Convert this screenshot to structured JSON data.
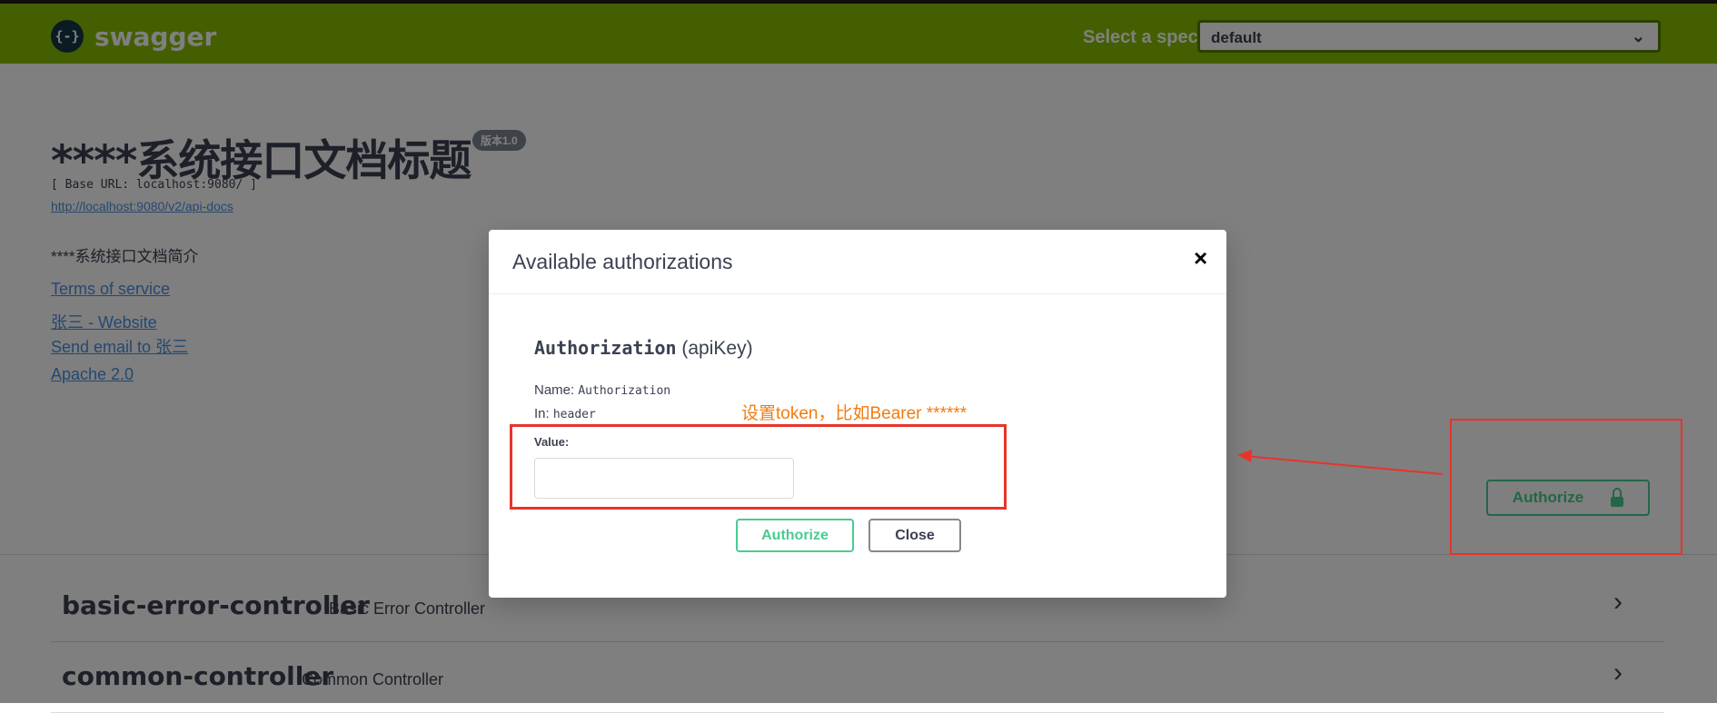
{
  "topbar": {
    "logo_glyph": "{-}",
    "logo_text": "swagger",
    "spec_label": "Select a spec",
    "spec_value": "default",
    "brand_color": "#89bf04"
  },
  "info": {
    "title": "****系统接口文档标题",
    "version": "版本1.0",
    "base_url": "[ Base URL: localhost:9080/ ]",
    "api_docs_link": "http://localhost:9080/v2/api-docs",
    "description": "****系统接口文档简介",
    "links": {
      "terms": "Terms of service",
      "website": "张三 - Website",
      "email": "Send email to 张三",
      "license": "Apache 2.0"
    }
  },
  "authorize_button": {
    "label": "Authorize",
    "icon": "lock-icon"
  },
  "tags": [
    {
      "name": "basic-error-controller",
      "description": "Basic Error Controller",
      "icon": "chevron-right-icon"
    },
    {
      "name": "common-controller",
      "description": "Common Controller",
      "icon": "chevron-right-icon"
    }
  ],
  "modal": {
    "title": "Available authorizations",
    "close_glyph": "×",
    "scheme_name": "Authorization",
    "scheme_type": " (apiKey)",
    "name_label": "Name: ",
    "name_value": "Authorization",
    "in_label": "In: ",
    "in_value": "header",
    "value_label": "Value:",
    "value_input": "",
    "authorize_label": "Authorize",
    "close_label": "Close"
  },
  "annotation": {
    "text": "设置token，比如Bearer ******",
    "color": "#e8332c",
    "text_color": "#f07c10"
  }
}
